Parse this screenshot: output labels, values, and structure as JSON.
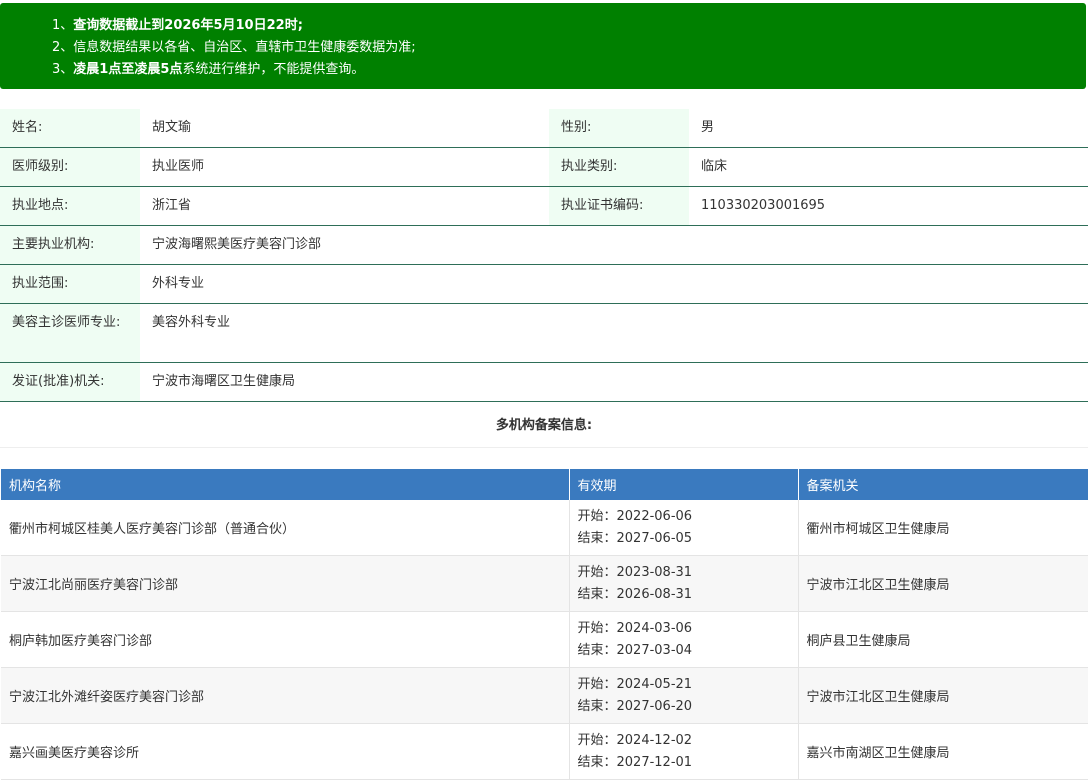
{
  "notice": {
    "line1_prefix": "1、",
    "line1_bold": "查询数据截止到2026年5月10日22时;",
    "line2": "2、信息数据结果以各省、自治区、直辖市卫生健康委数据为准;",
    "line3_prefix": "3、",
    "line3_bold": "凌晨1点至凌晨5点",
    "line3_suffix": "系统进行维护，不能提供查询。"
  },
  "profile": {
    "name_label": "姓名:",
    "name": "胡文瑜",
    "gender_label": "性别:",
    "gender": "男",
    "level_label": "医师级别:",
    "level": "执业医师",
    "category_label": "执业类别:",
    "category": "临床",
    "place_label": "执业地点:",
    "place": "浙江省",
    "cert_label": "执业证书编码:",
    "cert": "110330203001695",
    "org_label": "主要执业机构:",
    "org": "宁波海曙熙美医疗美容门诊部",
    "scope_label": "执业范围:",
    "scope": "外科专业",
    "beauty_label": "美容主诊医师专业:",
    "beauty": "美容外科专业",
    "issuer_label": "发证(批准)机关:",
    "issuer": "宁波市海曙区卫生健康局"
  },
  "multi": {
    "title": "多机构备案信息:",
    "headers": [
      "机构名称",
      "有效期",
      "备案机关"
    ],
    "rows": [
      {
        "name": "衢州市柯城区桂美人医疗美容门诊部（普通合伙）",
        "start": "开始：2022-06-06",
        "end": "结束：2027-06-05",
        "authority": "衢州市柯城区卫生健康局"
      },
      {
        "name": "宁波江北尚丽医疗美容门诊部",
        "start": "开始：2023-08-31",
        "end": "结束：2026-08-31",
        "authority": "宁波市江北区卫生健康局"
      },
      {
        "name": "桐庐韩加医疗美容门诊部",
        "start": "开始：2024-03-06",
        "end": "结束：2027-03-04",
        "authority": "桐庐县卫生健康局"
      },
      {
        "name": "宁波江北外滩纤姿医疗美容门诊部",
        "start": "开始：2024-05-21",
        "end": "结束：2027-06-20",
        "authority": "宁波市江北区卫生健康局"
      },
      {
        "name": "嘉兴画美医疗美容诊所",
        "start": "开始：2024-12-02",
        "end": "结束：2027-12-01",
        "authority": "嘉兴市南湖区卫生健康局"
      }
    ]
  }
}
